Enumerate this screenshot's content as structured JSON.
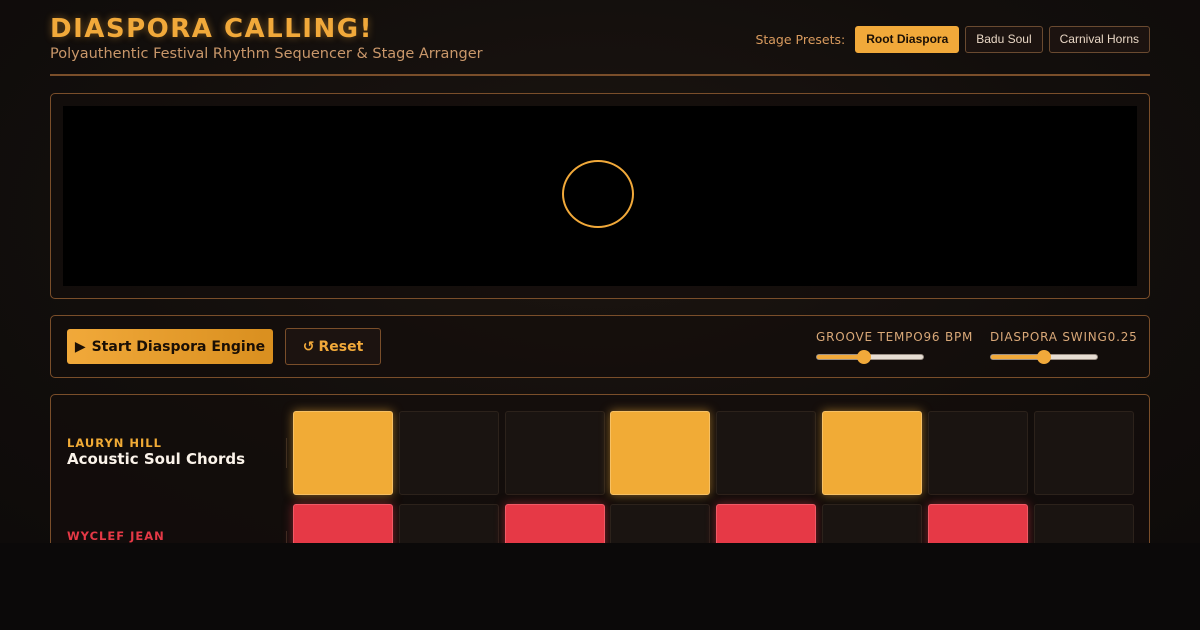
{
  "app": {
    "title": "DIASPORA CALLING!",
    "subtitle": "Polyauthentic Festival Rhythm Sequencer & Stage Arranger"
  },
  "presets": {
    "label": "Stage Presets:",
    "options": [
      "Root Diaspora",
      "Badu Soul",
      "Carnival Horns"
    ],
    "active": "Root Diaspora"
  },
  "stage": {
    "ring_color": "#f1a93a"
  },
  "controls": {
    "start_icon": "▶",
    "start_label": "Start Diaspora Engine",
    "reset_icon": "↺",
    "reset_label": "Reset",
    "tempo": {
      "label": "GROOVE TEMPO",
      "value_text": "96 BPM",
      "value": 96,
      "level": 0.44
    },
    "swing": {
      "label": "DIASPORA SWING",
      "value_text": "0.25",
      "value": 0.25,
      "level": 0.5
    }
  },
  "tracks": [
    {
      "artist": "LAURYN HILL",
      "part": "Acoustic Soul Chords",
      "color": "#f1ab36",
      "steps": [
        true,
        false,
        false,
        true,
        false,
        true,
        false,
        false
      ]
    },
    {
      "artist": "WYCLEF JEAN",
      "part": "",
      "color": "#e63946",
      "steps": [
        true,
        false,
        true,
        false,
        true,
        false,
        true,
        false
      ]
    }
  ],
  "colors": {
    "accent": "#f1a93a",
    "accent_red": "#e63946",
    "border": "#7a4e2a",
    "background": "#120e0c"
  }
}
